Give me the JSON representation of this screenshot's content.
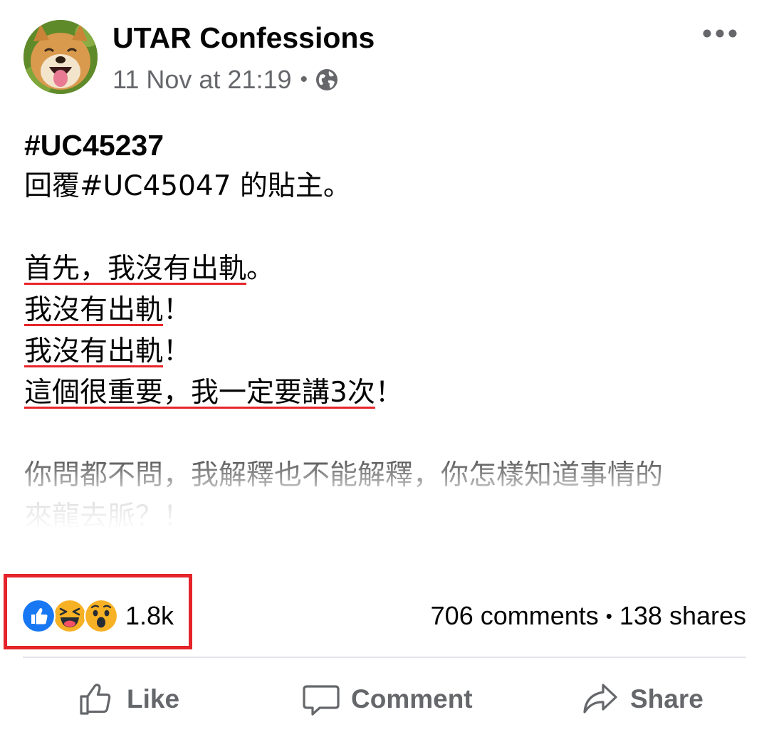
{
  "post": {
    "page_name": "UTAR Confessions",
    "timestamp": "11 Nov at 21:19",
    "meta_separator": "•",
    "audience_icon": "globe-icon",
    "more_icon": "more-options-icon",
    "body": {
      "hashtag": "#UC45237",
      "line2": "回覆#UC45047 的貼主。",
      "line3_underlined": "首先，我沒有出軌",
      "line3_rest": "。",
      "line4_underlined": "我沒有出軌",
      "line4_rest": "！",
      "line5_underlined": "我沒有出軌",
      "line5_rest": "！",
      "line6_underlined": "這個很重要，我一定要講3次",
      "line6_rest": "！",
      "line7": "你問都不問，我解釋也不能解釋，你怎樣知道事情的",
      "line8": "來龍去脈？！"
    }
  },
  "reactions": {
    "icons": [
      "like-reaction-icon",
      "haha-reaction-icon",
      "wow-reaction-icon"
    ],
    "count": "1.8k"
  },
  "stats": {
    "comments": "706 comments",
    "separator": "•",
    "shares": "138 shares"
  },
  "actions": {
    "like_label": "Like",
    "comment_label": "Comment",
    "share_label": "Share"
  },
  "colors": {
    "highlight_box": "#e5232b",
    "underline": "#e8242a",
    "like_blue": "#1877f2",
    "emoji_yellow": "#f7b125",
    "secondary_text": "#65676b"
  }
}
